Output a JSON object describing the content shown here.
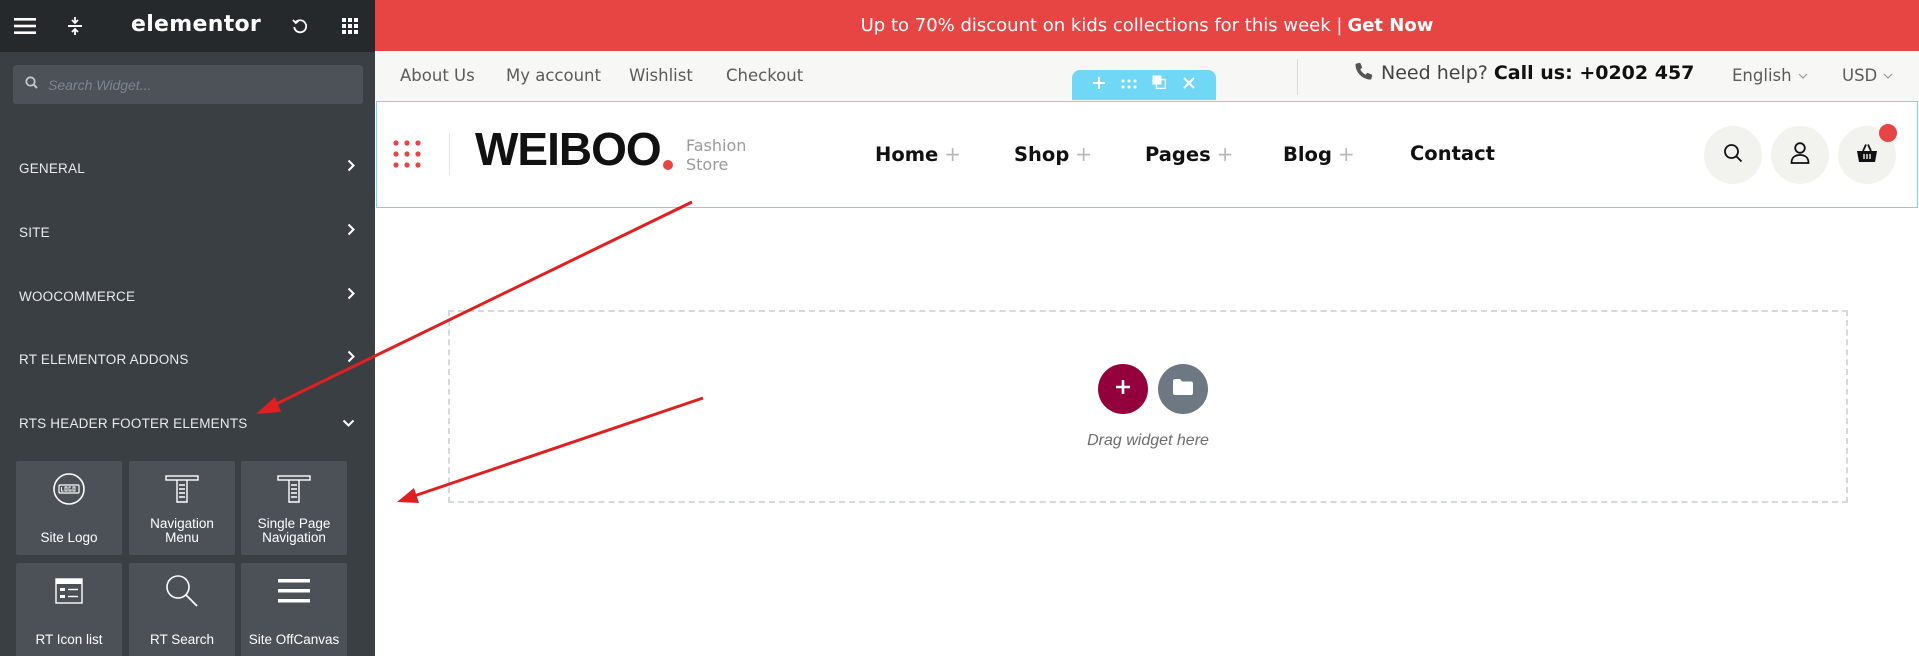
{
  "sidebar": {
    "logo": "elementor",
    "search_placeholder": "Search Widget...",
    "categories": [
      {
        "label": "GENERAL",
        "state": "collapsed"
      },
      {
        "label": "SITE",
        "state": "collapsed"
      },
      {
        "label": "WOOCOMMERCE",
        "state": "collapsed"
      },
      {
        "label": "RT ELEMENTOR ADDONS",
        "state": "collapsed"
      },
      {
        "label": "RTS HEADER FOOTER ELEMENTS",
        "state": "expanded"
      }
    ],
    "widgets": [
      {
        "label": "Site Logo",
        "icon": "site-logo-icon"
      },
      {
        "label": "Navigation Menu",
        "icon": "navigation-menu-icon"
      },
      {
        "label": "Single Page Navigation",
        "icon": "single-page-navigation-icon"
      },
      {
        "label": "RT Icon list",
        "icon": "icon-list-icon"
      },
      {
        "label": "RT Search",
        "icon": "search-icon"
      },
      {
        "label": "Site OffCanvas",
        "icon": "hamburger-icon"
      }
    ]
  },
  "preview": {
    "promo": {
      "text": "Up to 70% discount on kids collections for this week |",
      "cta": "Get Now",
      "color": "#e74444"
    },
    "info_links": [
      "About Us",
      "My account",
      "Wishlist",
      "Checkout"
    ],
    "help": {
      "text": "Need help?",
      "call": "Call us: +0202 457"
    },
    "language": "English",
    "currency": "USD",
    "brand": {
      "name": "WEIBOO",
      "tagline_line1": "Fashion",
      "tagline_line2": "Store"
    },
    "nav": [
      {
        "label": "Home",
        "plus": "+"
      },
      {
        "label": "Shop",
        "plus": "+"
      },
      {
        "label": "Pages",
        "plus": "+"
      },
      {
        "label": "Blog",
        "plus": "+"
      },
      {
        "label": "Contact",
        "plus": ""
      }
    ],
    "dropzone_text": "Drag widget here"
  },
  "colors": {
    "accent_red": "#e74444",
    "editor_cyan": "#71d7f7",
    "add_button": "#93003c",
    "sidebar_bg": "#3a3f44"
  }
}
